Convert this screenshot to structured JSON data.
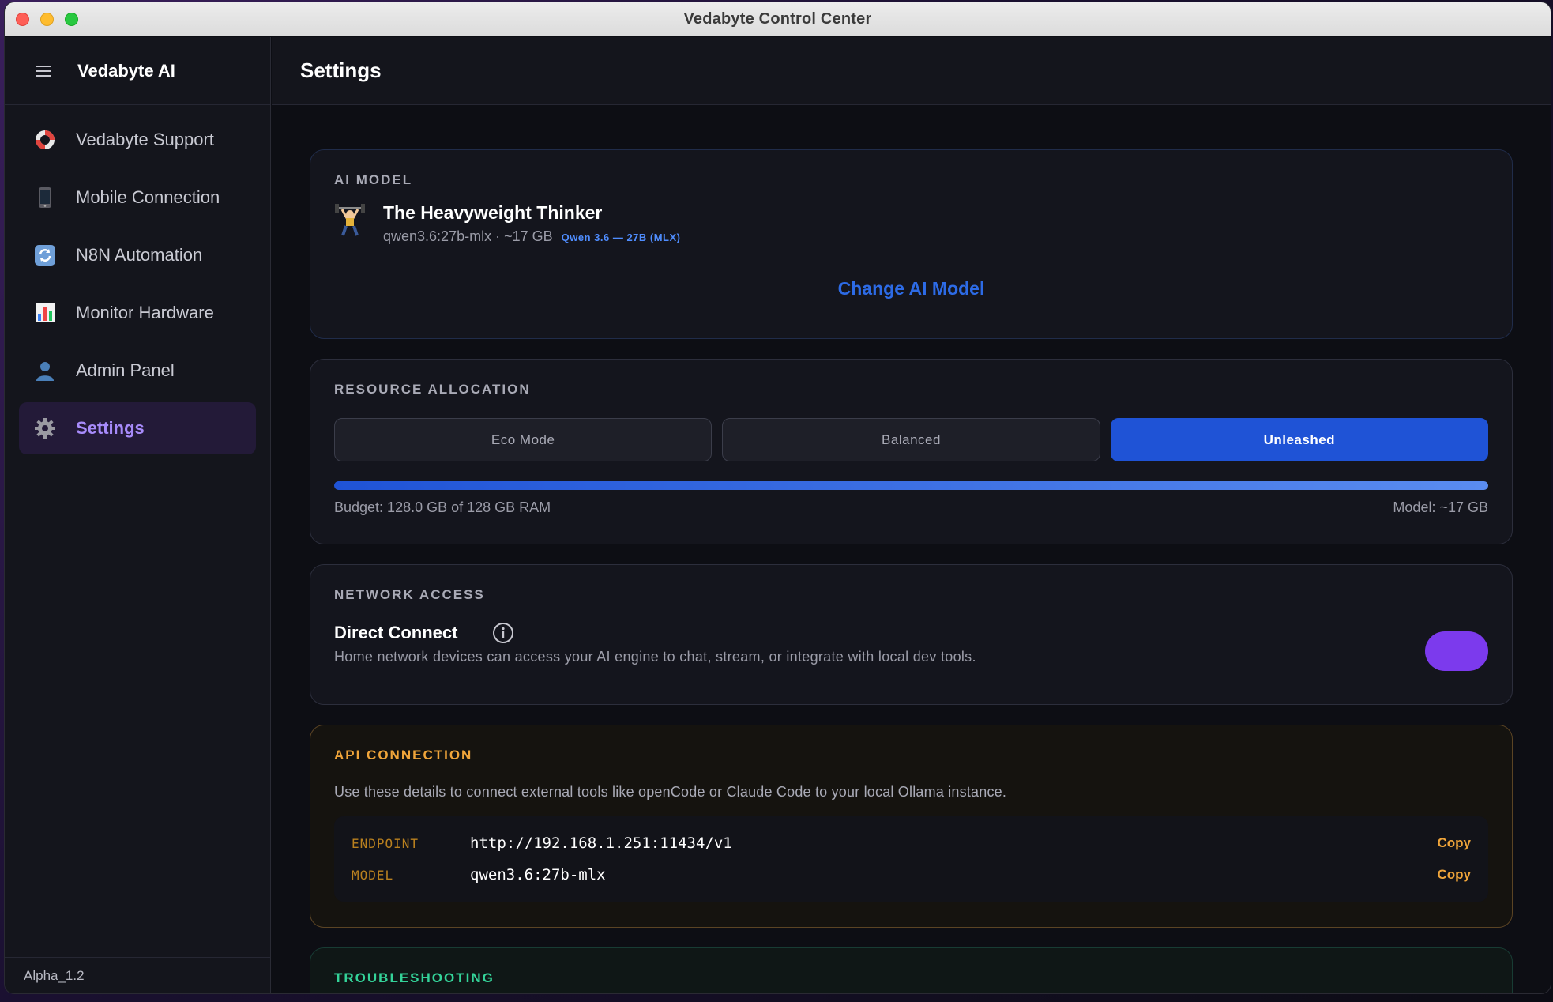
{
  "window": {
    "title": "Vedabyte Control Center"
  },
  "sidebar": {
    "brand": "Vedabyte AI",
    "items": [
      {
        "label": "Vedabyte Support",
        "icon": "lifebuoy-icon"
      },
      {
        "label": "Mobile Connection",
        "icon": "mobile-phone-icon"
      },
      {
        "label": "N8N Automation",
        "icon": "sync-icon"
      },
      {
        "label": "Monitor Hardware",
        "icon": "bar-chart-icon"
      },
      {
        "label": "Admin Panel",
        "icon": "user-icon"
      },
      {
        "label": "Settings",
        "icon": "gear-icon",
        "active": true
      }
    ],
    "version": "Alpha_1.2"
  },
  "header": {
    "title": "Settings"
  },
  "ai_model": {
    "section_label": "AI MODEL",
    "name": "The Heavyweight Thinker",
    "meta": "qwen3.6:27b-mlx · ~17 GB",
    "tag": "Qwen 3.6 — 27B (MLX)",
    "change_button": "Change AI Model"
  },
  "resource": {
    "section_label": "RESOURCE ALLOCATION",
    "modes": [
      "Eco Mode",
      "Balanced",
      "Unleashed"
    ],
    "active_mode": "Unleashed",
    "budget_fraction": 1.0,
    "budget_text": "Budget: 128.0 GB of 128 GB RAM",
    "model_text": "Model: ~17 GB"
  },
  "network": {
    "section_label": "NETWORK ACCESS",
    "title": "Direct Connect",
    "description": "Home network devices can access your AI engine to chat, stream, or integrate with local dev tools.",
    "enabled": true
  },
  "api": {
    "section_label": "API CONNECTION",
    "description": "Use these details to connect external tools like openCode or Claude Code to your local Ollama instance.",
    "rows": [
      {
        "key": "ENDPOINT",
        "value": "http://192.168.1.251:11434/v1",
        "action": "Copy"
      },
      {
        "key": "MODEL",
        "value": "qwen3.6:27b-mlx",
        "action": "Copy"
      }
    ]
  },
  "troubleshooting": {
    "section_label": "TROUBLESHOOTING"
  },
  "colors": {
    "accent": "#a78bfa",
    "primary": "#1f53d6",
    "api": "#f0a53a",
    "trouble": "#34d399",
    "toggle": "#7c3aed"
  }
}
